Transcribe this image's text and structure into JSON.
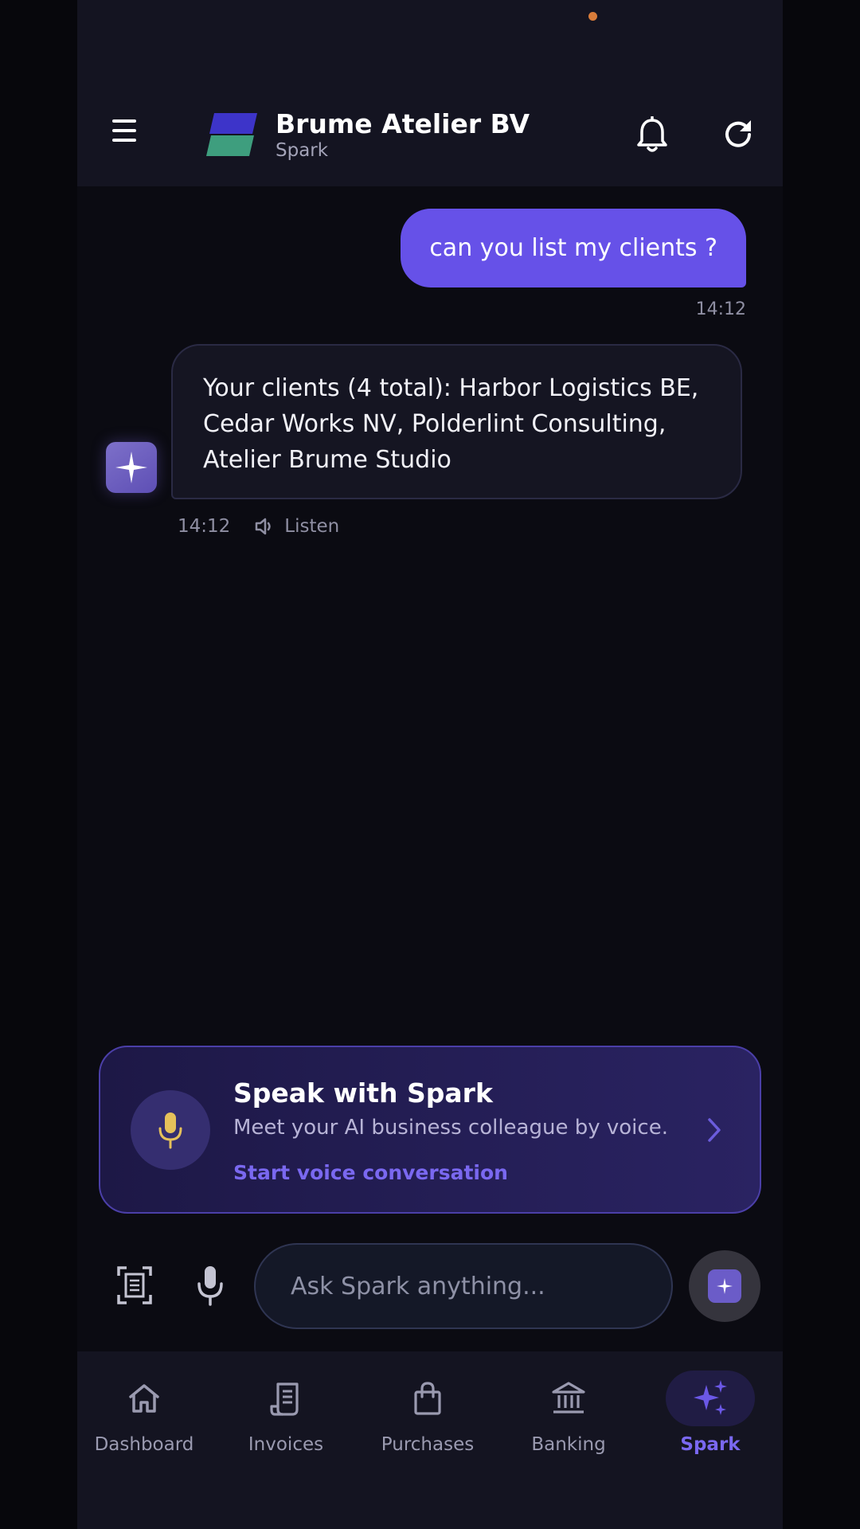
{
  "header": {
    "company_name": "Brume Atelier BV",
    "subtitle": "Spark"
  },
  "chat": {
    "user_message": "can you list my clients ?",
    "user_time": "14:12",
    "bot_message": "Your clients (4 total): Harbor Logistics BE, Cedar Works NV, Polderlint Consulting, Atelier Brume Studio",
    "bot_time": "14:12",
    "listen_label": "Listen"
  },
  "voice_card": {
    "title": "Speak with Spark",
    "description": "Meet your AI business colleague by voice.",
    "link_label": "Start voice conversation"
  },
  "composer": {
    "placeholder": "Ask Spark anything..."
  },
  "nav": {
    "items": [
      {
        "label": "Dashboard",
        "icon": "home-icon"
      },
      {
        "label": "Invoices",
        "icon": "receipt-icon"
      },
      {
        "label": "Purchases",
        "icon": "shopping-bag-icon"
      },
      {
        "label": "Banking",
        "icon": "bank-icon"
      },
      {
        "label": "Spark",
        "icon": "sparkles-icon",
        "active": true
      }
    ]
  },
  "colors": {
    "accent": "#6651e8",
    "accent_text": "#7a68f0",
    "background": "#0b0b12",
    "header": "#141421",
    "mic_yellow": "#e6c15a",
    "logo_blue": "#3d34c9",
    "logo_green": "#3e9e7e",
    "status_dot": "#d87c3a"
  }
}
